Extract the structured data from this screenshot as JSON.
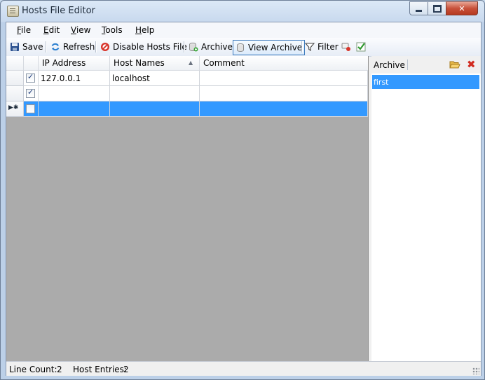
{
  "window": {
    "title": "Hosts File Editor"
  },
  "menu": [
    {
      "key": "F",
      "rest": "ile"
    },
    {
      "key": "E",
      "rest": "dit"
    },
    {
      "key": "V",
      "rest": "iew"
    },
    {
      "key": "T",
      "rest": "ools"
    },
    {
      "key": "H",
      "rest": "elp"
    }
  ],
  "toolbar": {
    "save": "Save",
    "refresh": "Refresh",
    "disable": "Disable Hosts File",
    "archive": "Archive",
    "view_archive": "View Archive",
    "filter": "Filter"
  },
  "grid": {
    "columns": [
      "IP Address",
      "Host Names",
      "Comment"
    ],
    "rows": [
      {
        "enabled": true,
        "ip": "127.0.0.1",
        "host": "localhost",
        "comment": ""
      },
      {
        "enabled": true,
        "ip": "",
        "host": "",
        "comment": ""
      },
      {
        "enabled": false,
        "ip": "",
        "host": "",
        "comment": "",
        "new_row": true
      }
    ]
  },
  "archive_panel": {
    "title": "Archive",
    "items": [
      "first"
    ]
  },
  "status": {
    "line_count_label": "Line Count:",
    "line_count": "2",
    "host_entries_label": "Host Entries:",
    "host_entries": "2"
  },
  "colors": {
    "selection": "#3399ff",
    "grid_empty": "#ababab"
  }
}
